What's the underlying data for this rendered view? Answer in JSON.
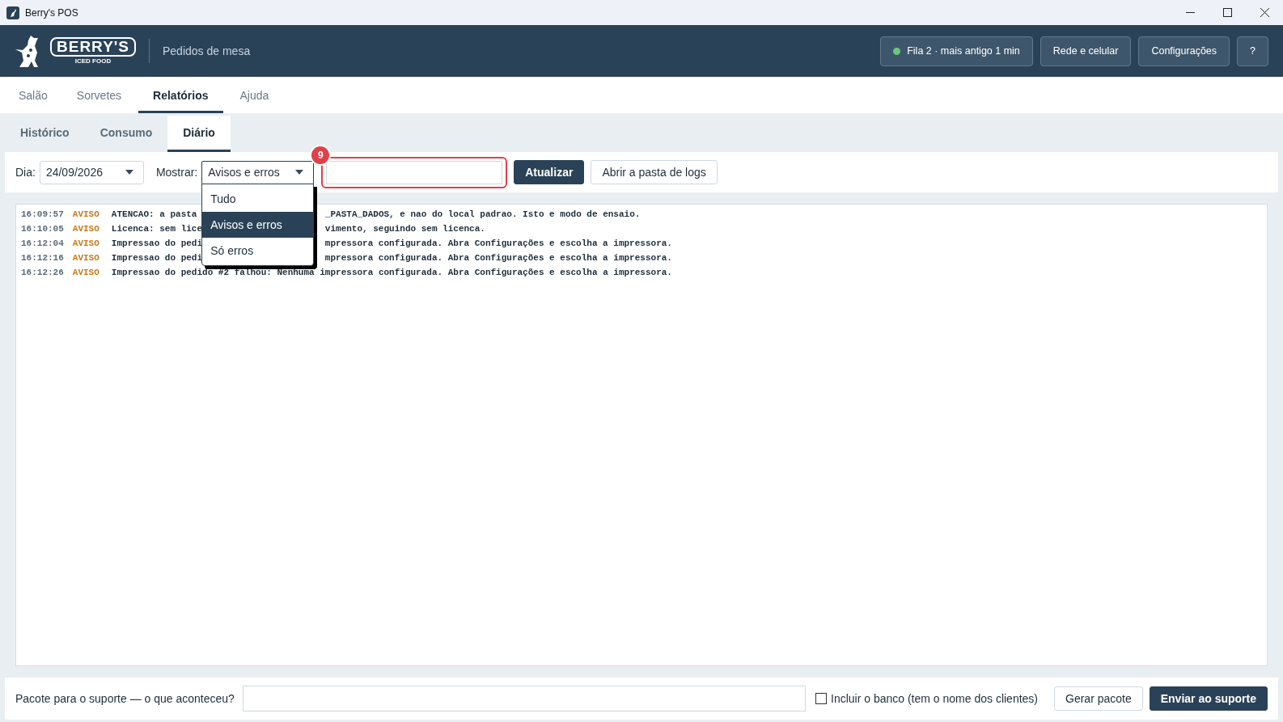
{
  "window": {
    "title": "Berry's POS"
  },
  "header": {
    "logo": {
      "brand": "BERRY'S",
      "tagline": "ICED FOOD"
    },
    "subtitle": "Pedidos de mesa",
    "queue": {
      "label": "Fila 2 · mais antigo 1 min",
      "color": "#6cc77e"
    },
    "buttons": [
      "Rede e celular",
      "Configurações",
      "?"
    ]
  },
  "tabs": [
    {
      "label": "Salão",
      "selected": false
    },
    {
      "label": "Sorvetes",
      "selected": false
    },
    {
      "label": "Relatórios",
      "selected": true
    },
    {
      "label": "Ajuda",
      "selected": false
    }
  ],
  "subtabs": [
    {
      "label": "Histórico",
      "selected": false
    },
    {
      "label": "Consumo",
      "selected": false
    },
    {
      "label": "Diário",
      "selected": true
    }
  ],
  "toolbar": {
    "day_label": "Dia:",
    "day": "24/09/2026",
    "show_label": "Mostrar:",
    "show": "Avisos e erros",
    "search": {
      "highlighted": true,
      "annotation": "9"
    },
    "buttons": [
      "Atualizar",
      "Abrir a pasta de logs"
    ]
  },
  "show_menu": {
    "expanded": true,
    "options": [
      {
        "label": "Tudo",
        "selected": false
      },
      {
        "label": "Avisos e erros",
        "selected": true
      },
      {
        "label": "Só erros",
        "selected": false
      }
    ]
  },
  "log": [
    {
      "time": "16:09:57",
      "level": "AVISO",
      "message_start": "ATENCAO: a pasta",
      "message_end": "_PASTA_DADOS, e nao do local padrao. Isto e modo de ensaio."
    },
    {
      "time": "16:10:05",
      "level": "AVISO",
      "message_start": "Licenca: sem lice",
      "message_end": "vimento, seguindo sem licenca."
    },
    {
      "time": "16:12:04",
      "level": "AVISO",
      "message_start": "Impressao do pedi",
      "message_end": "mpressora configurada. Abra Configurações e escolha a impressora."
    },
    {
      "time": "16:12:16",
      "level": "AVISO",
      "message_start": "Impressao do pedi",
      "message_end": "mpressora configurada. Abra Configurações e escolha a impressora."
    },
    {
      "time": "16:12:26",
      "level": "AVISO",
      "message_start": "Impressao do pedido #2 falhou: Nenhuma impressora configurada. Abra Configurações e escolha a impressora."
    }
  ],
  "support": {
    "label": "Pacote para o suporte — o que aconteceu?",
    "include_db": {
      "label": "Incluir o banco (tem o nome dos clientes)",
      "checked": false
    },
    "buttons": [
      {
        "label": "Gerar pacote",
        "kind": "secondary"
      },
      {
        "label": "Enviar ao suporte",
        "kind": "primary"
      }
    ]
  }
}
